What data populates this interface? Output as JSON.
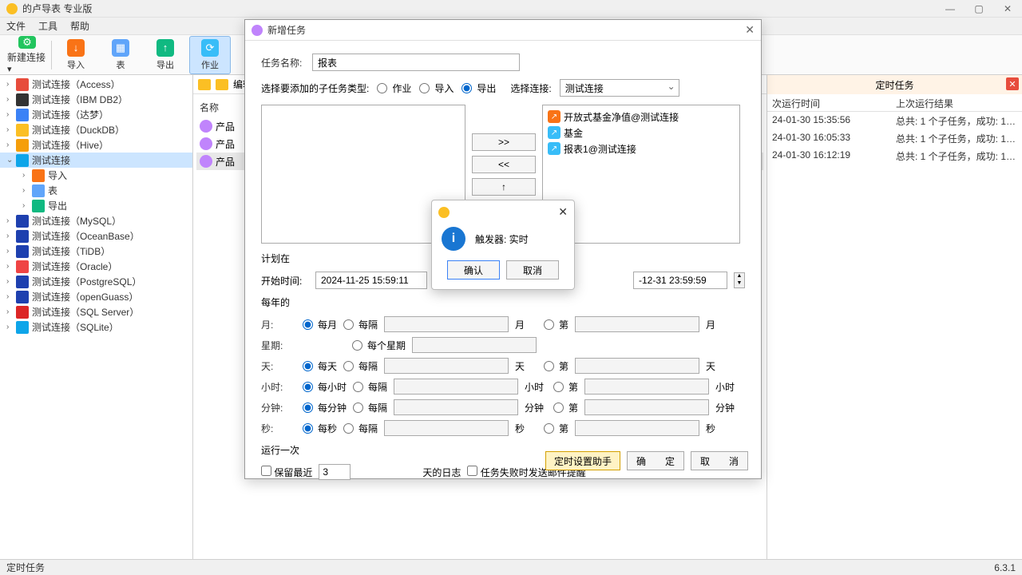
{
  "window": {
    "title": "的卢导表 专业版"
  },
  "menu": {
    "file": "文件",
    "tools": "工具",
    "help": "帮助"
  },
  "toolbar": {
    "new_conn": "新建连接",
    "import": "导入",
    "table": "表",
    "export": "导出",
    "job": "作业"
  },
  "connections": [
    {
      "label": "测试连接（Access）",
      "color": "#e74c3c"
    },
    {
      "label": "测试连接（IBM DB2）",
      "color": "#333"
    },
    {
      "label": "测试连接（达梦）",
      "color": "#3b82f6"
    },
    {
      "label": "测试连接（DuckDB）",
      "color": "#fbbf24"
    },
    {
      "label": "测试连接（Hive）",
      "color": "#f59e0b"
    },
    {
      "label": "测试连接",
      "color": "#0ea5e9",
      "selected": true,
      "expanded": true,
      "children": [
        {
          "label": "导入",
          "color": "#f97316"
        },
        {
          "label": "表",
          "color": "#60a5fa"
        },
        {
          "label": "导出",
          "color": "#10b981"
        }
      ]
    },
    {
      "label": "测试连接（MySQL）",
      "color": "#1e40af"
    },
    {
      "label": "测试连接（OceanBase）",
      "color": "#1e40af"
    },
    {
      "label": "测试连接（TiDB）",
      "color": "#1e40af"
    },
    {
      "label": "测试连接（Oracle）",
      "color": "#ef4444"
    },
    {
      "label": "测试连接（PostgreSQL）",
      "color": "#1e40af"
    },
    {
      "label": "测试连接（openGuass）",
      "color": "#1e40af"
    },
    {
      "label": "测试连接（SQL Server）",
      "color": "#dc2626"
    },
    {
      "label": "测试连接（SQLite）",
      "color": "#0ea5e9"
    }
  ],
  "center": {
    "edit": "编辑",
    "name_header": "名称",
    "items": [
      "产品",
      "产品",
      "产品"
    ]
  },
  "right": {
    "title": "定时任务",
    "col_time": "次运行时间",
    "col_result": "上次运行结果",
    "rows": [
      {
        "time": "24-01-30 15:35:56",
        "result": "总共: 1 个子任务，成功: 1…"
      },
      {
        "time": "24-01-30 16:05:33",
        "result": "总共: 1 个子任务，成功: 1…"
      },
      {
        "time": "24-01-30 16:12:19",
        "result": "总共: 1 个子任务，成功: 1…"
      }
    ]
  },
  "status": {
    "left": "定时任务",
    "version": "6.3.1"
  },
  "modal": {
    "title": "新增任务",
    "task_name_label": "任务名称:",
    "task_name_value": "报表",
    "subtype_label": "选择要添加的子任务类型:",
    "opt_job": "作业",
    "opt_import": "导入",
    "opt_export": "导出",
    "conn_label": "选择连接:",
    "conn_value": "测试连接",
    "right_items": [
      {
        "label": "开放式基金净值@测试连接",
        "color": "#f97316"
      },
      {
        "label": "基金",
        "color": "#38bdf8"
      },
      {
        "label": "报表1@测试连接",
        "color": "#38bdf8"
      }
    ],
    "btn_right": ">>",
    "btn_left": "<<",
    "btn_up": "↑",
    "plan_label": "计划在",
    "start_label": "开始时间:",
    "start_value": "2024-11-25 15:59:11",
    "end_value": "-12-31 23:59:59",
    "every_year": "每年的",
    "rows": {
      "month": {
        "label": "月:",
        "r1": "每月",
        "r2": "每隔",
        "u1": "月",
        "r3": "第",
        "u2": "月"
      },
      "week": {
        "label": "星期:",
        "r2": "每个星期"
      },
      "day": {
        "label": "天:",
        "r1": "每天",
        "r2": "每隔",
        "u1": "天",
        "r3": "第",
        "u2": "天"
      },
      "hour": {
        "label": "小时:",
        "r1": "每小时",
        "r2": "每隔",
        "u1": "小时",
        "r3": "第",
        "u2": "小时"
      },
      "minute": {
        "label": "分钟:",
        "r1": "每分钟",
        "r2": "每隔",
        "u1": "分钟",
        "r3": "第",
        "u2": "分钟"
      },
      "second": {
        "label": "秒:",
        "r1": "每秒",
        "r2": "每隔",
        "u1": "秒",
        "r3": "第",
        "u2": "秒"
      }
    },
    "run_once": "运行一次",
    "keep_log": "保留最近",
    "keep_log_val": "3",
    "keep_log_suffix": "天的日志",
    "fail_mail": "任务失败时发送邮件提醒",
    "btn_helper": "定时设置助手",
    "btn_ok": "确　　定",
    "btn_cancel": "取　　消"
  },
  "alert": {
    "message": "触发器: 实时",
    "ok": "确认",
    "cancel": "取消"
  }
}
